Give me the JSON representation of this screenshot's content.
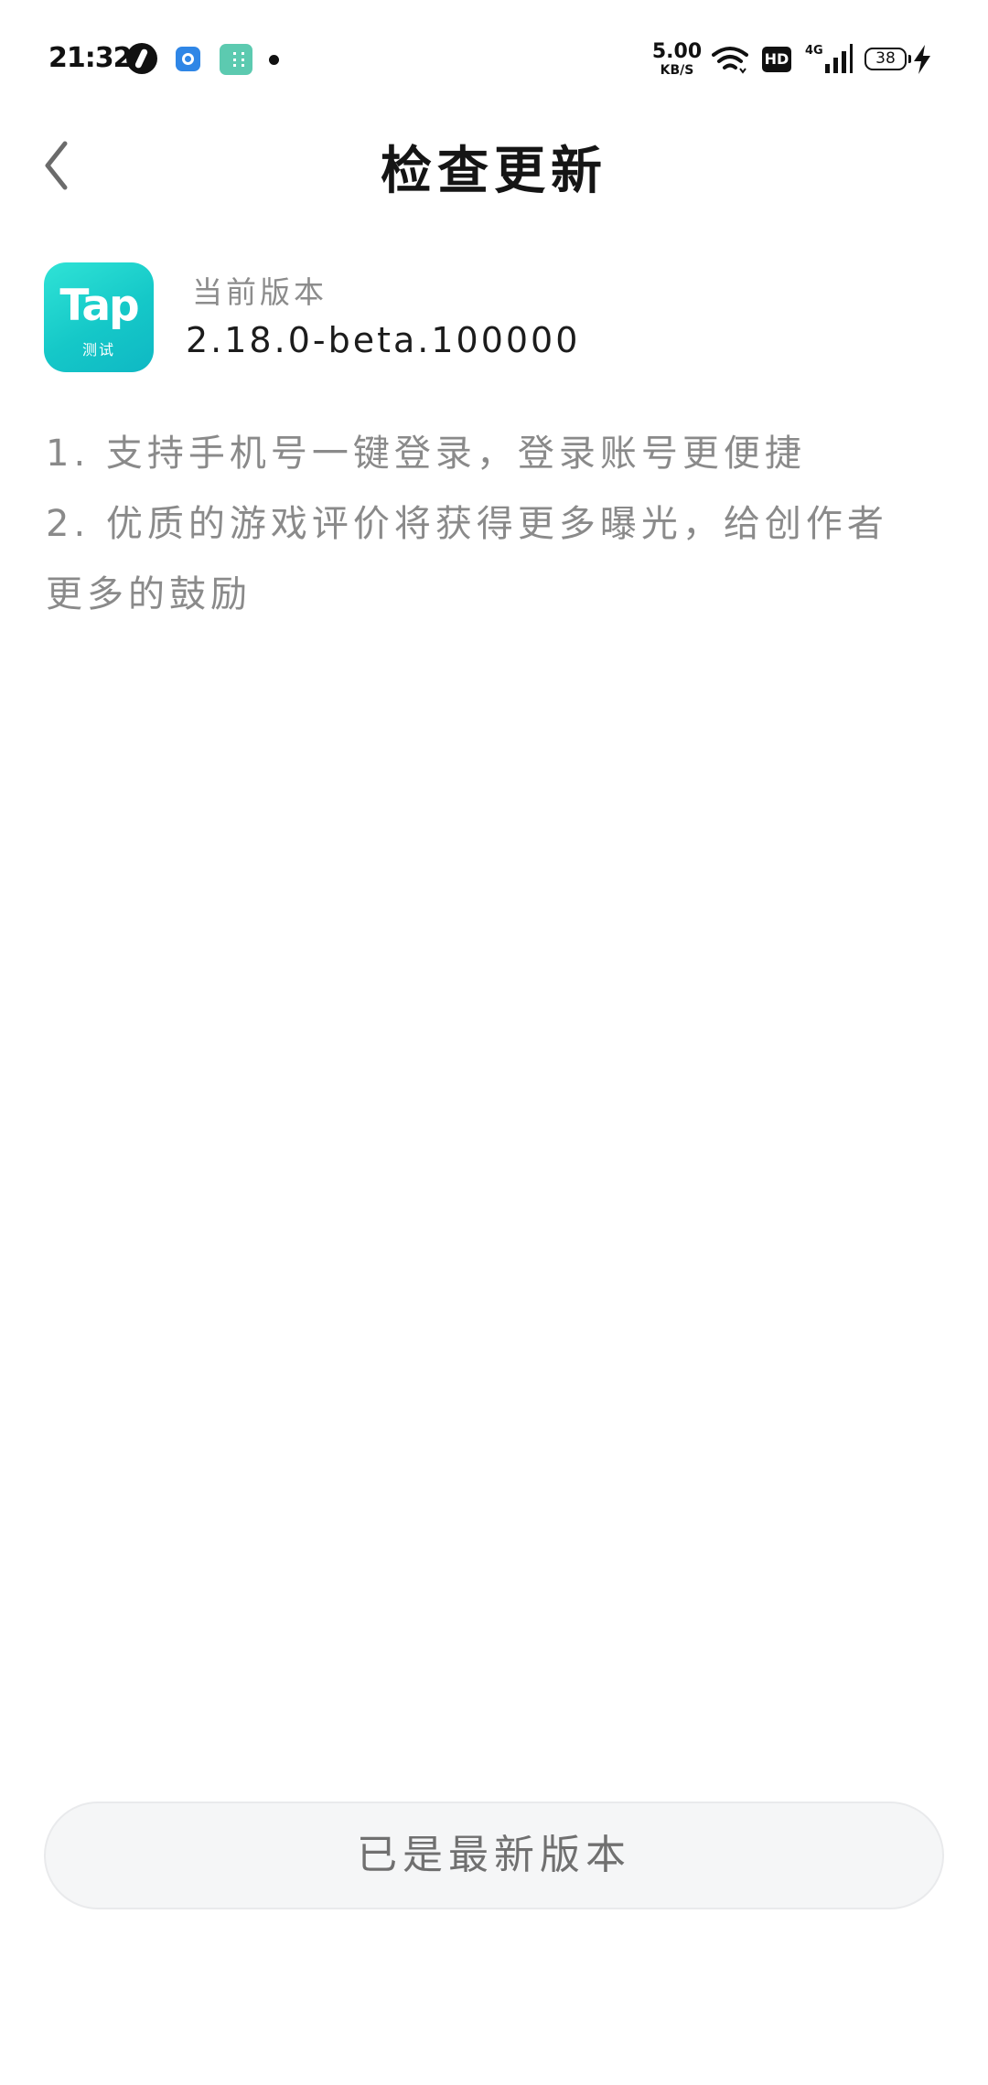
{
  "status_bar": {
    "time": "21:32",
    "net_speed_value": "5.00",
    "net_speed_unit": "KB/S",
    "hd_label": "HD",
    "network_label": "4G",
    "battery_level": "38",
    "icons": [
      "app-notification-icon",
      "browser-notification-icon",
      "app-store-notification-icon",
      "more-notifications-dot",
      "wifi-icon",
      "hd-icon",
      "cellular-signal-icon",
      "battery-icon",
      "charging-bolt-icon"
    ]
  },
  "header": {
    "back_icon": "chevron-left-icon",
    "title": "检查更新"
  },
  "version": {
    "icon_text": "Tap",
    "icon_subtext": "测试",
    "label": "当前版本",
    "number": "2.18.0-beta.100000"
  },
  "release_notes": [
    "1. 支持手机号一键登录，登录账号更便捷",
    "2. 优质的游戏评价将获得更多曝光，给创作者更多的鼓励"
  ],
  "action": {
    "button_label": "已是最新版本"
  },
  "colors": {
    "icon_gradient_start": "#2fe3d6",
    "icon_gradient_end": "#0fb8c4",
    "note_text": "#8a8a8a",
    "button_bg": "#f5f6f7"
  }
}
